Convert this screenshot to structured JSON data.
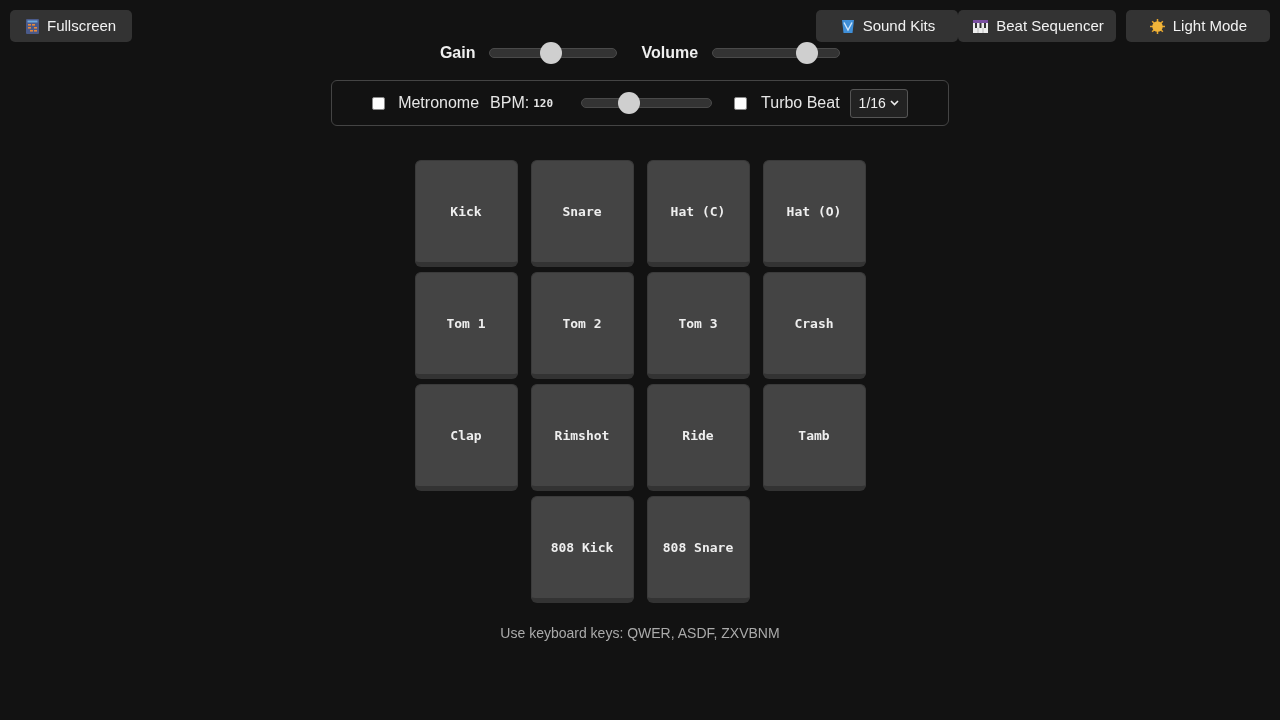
{
  "header": {
    "fullscreen_button": {
      "label": "Fullscreen"
    },
    "sound_kits_button": {
      "label": "Sound Kits"
    },
    "beat_sequencer_button": {
      "label": "Beat Sequencer"
    },
    "light_mode_button": {
      "label": "Light Mode"
    }
  },
  "mixer": [
    {
      "label": "Gain",
      "level": 0.48
    },
    {
      "label": "Volume",
      "level": 0.8
    }
  ],
  "controls": {
    "metronome": {
      "label": "Metronome",
      "checked": false
    },
    "bpm": {
      "label": "BPM:",
      "value": "120",
      "level": 0.34
    },
    "turbo_beat": {
      "label": "Turbo Beat",
      "checked": false
    },
    "subdivision": {
      "value": "1/16"
    }
  },
  "pads": [
    {
      "label": "Kick"
    },
    {
      "label": "Snare"
    },
    {
      "label": "Hat (C)"
    },
    {
      "label": "Hat (O)"
    },
    {
      "label": "Tom 1"
    },
    {
      "label": "Tom 2"
    },
    {
      "label": "Tom 3"
    },
    {
      "label": "Crash"
    },
    {
      "label": "Clap"
    },
    {
      "label": "Rimshot"
    },
    {
      "label": "Ride"
    },
    {
      "label": "Tamb"
    },
    {
      "label": "808 Kick"
    },
    {
      "label": "808 Snare"
    }
  ],
  "footer": {
    "hint": "Use keyboard keys: QWER, ASDF, ZXVBNM"
  }
}
